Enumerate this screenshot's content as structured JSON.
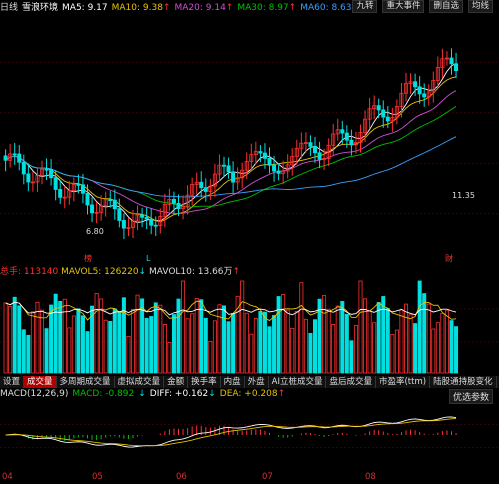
{
  "header": {
    "period": "日线",
    "stock_name": "雪浪环境",
    "ma5_label": "MA5: 9.17",
    "ma10_label": "MA10: 9.38",
    "ma20_label": "MA20: 9.14",
    "ma30_label": "MA30: 8.97",
    "ma60_label": "MA60: 8.63",
    "down_arrow": "↓",
    "up_arrow": "↑",
    "buttons": [
      "九转",
      "重大事件",
      "删自选",
      "均线"
    ],
    "colors": {
      "ma5": "#ffffff",
      "ma10": "#e6c300",
      "ma20": "#d050d0",
      "ma30": "#00c000",
      "ma60": "#3aa0ff",
      "up": "#ff3030",
      "down": "#00e0e0"
    }
  },
  "price_chart": {
    "high_label": "11.35",
    "low_label": "6.80",
    "marker_bottom_left": "榜",
    "marker_bottom_mid": "L",
    "marker_bottom_right": "财"
  },
  "volume": {
    "label": "总手: 113140",
    "mavol5": "MAVOL5: 126220",
    "mavol10": "MAVOL10: 13.66万",
    "up_arrow": "↑",
    "down_arrow": "↓"
  },
  "tabs": [
    "设置",
    "成交量",
    "多周期成交量",
    "虚拟成交量",
    "金额",
    "换手率",
    "内盘",
    "外盘",
    "AI立桩成交量",
    "盘后成交量",
    "市盈率(ttm)",
    "陆股通持股变化"
  ],
  "macd": {
    "label": "MACD(12,26,9)",
    "macd_value": "MACD: -0.892",
    "diff_value": "DIFF: +0.162",
    "dea_value": "DEA: +0.208",
    "optimize_label": "优选参数"
  },
  "xaxis": [
    "04",
    "05",
    "06",
    "07",
    "08"
  ],
  "chart_data": {
    "type": "candlestick",
    "title": "雪浪环境 日线",
    "series": [
      {
        "name": "MA5",
        "value": 9.17
      },
      {
        "name": "MA10",
        "value": 9.38
      },
      {
        "name": "MA20",
        "value": 9.14
      },
      {
        "name": "MA30",
        "value": 8.97
      },
      {
        "name": "MA60",
        "value": 8.63
      }
    ],
    "price_low": 6.8,
    "price_high": 11.35,
    "volume_last": 113140,
    "mavol5": 126220,
    "mavol10": "13.66万",
    "macd": -0.892,
    "diff": 0.162,
    "dea": 0.208,
    "months": [
      "04",
      "05",
      "06",
      "07",
      "08"
    ]
  }
}
